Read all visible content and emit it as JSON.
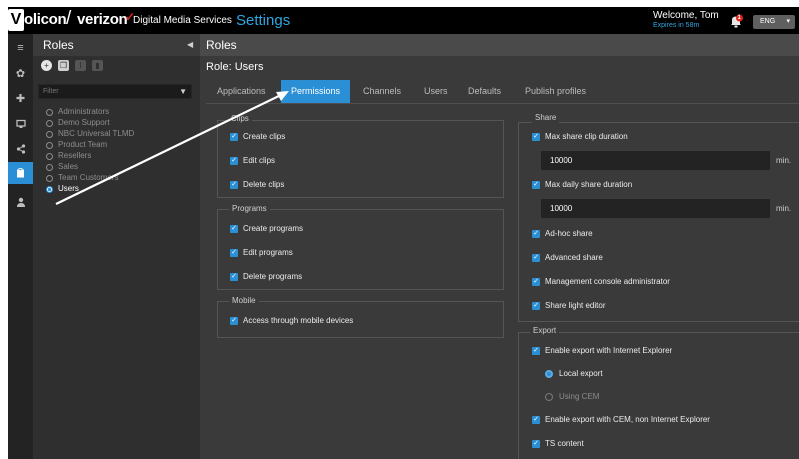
{
  "header": {
    "logo_letter": "V",
    "logo_text": "olicon",
    "logo_separator": "/",
    "logo_partner": "verizon",
    "logo_partner_mark": "✓",
    "service_name": "Digital Media Services",
    "section_title": "Settings",
    "welcome_text": "Welcome, Tom",
    "expires_text": "Expires in 58m",
    "notification_count": "1",
    "language": "ENG"
  },
  "sidebar": {
    "title": "Roles",
    "filter_placeholder": "Filter",
    "roles": [
      "Administrators",
      "Demo Support",
      "NBC Universal TLMD",
      "Product Team",
      "Resellers",
      "Sales",
      "Team Customers",
      "Users"
    ],
    "selected_role": "Users"
  },
  "main": {
    "title": "Roles",
    "role_title": "Role: Users",
    "tabs": [
      "Applications",
      "Permissions",
      "Channels",
      "Users",
      "Defaults",
      "Publish profiles"
    ],
    "active_tab": "Permissions",
    "groups": {
      "clips": {
        "label": "Clips",
        "items": [
          "Create clips",
          "Edit clips",
          "Delete clips"
        ]
      },
      "programs": {
        "label": "Programs",
        "items": [
          "Create programs",
          "Edit programs",
          "Delete programs"
        ]
      },
      "mobile": {
        "label": "Mobile",
        "items": [
          "Access through mobile devices"
        ]
      },
      "share": {
        "label": "Share",
        "max_clip_label": "Max share clip duration",
        "max_clip_value": "10000",
        "max_daily_label": "Max daily share duration",
        "max_daily_value": "10000",
        "unit": "min.",
        "items": [
          "Ad-hoc share",
          "Advanced share",
          "Management console administrator",
          "Share light editor"
        ]
      },
      "export": {
        "label": "Export",
        "enable_ie": "Enable export with Internet Explorer",
        "local_export": "Local export",
        "using_cem": "Using CEM",
        "enable_cem": "Enable export with CEM, non Internet Explorer",
        "ts_content": "TS content"
      }
    }
  },
  "colors": {
    "accent": "#2b8fd6",
    "header_bg": "#000000",
    "panel_bg": "#2f2f2f",
    "main_bg": "#3a3a3a",
    "alert": "#e2231a"
  }
}
